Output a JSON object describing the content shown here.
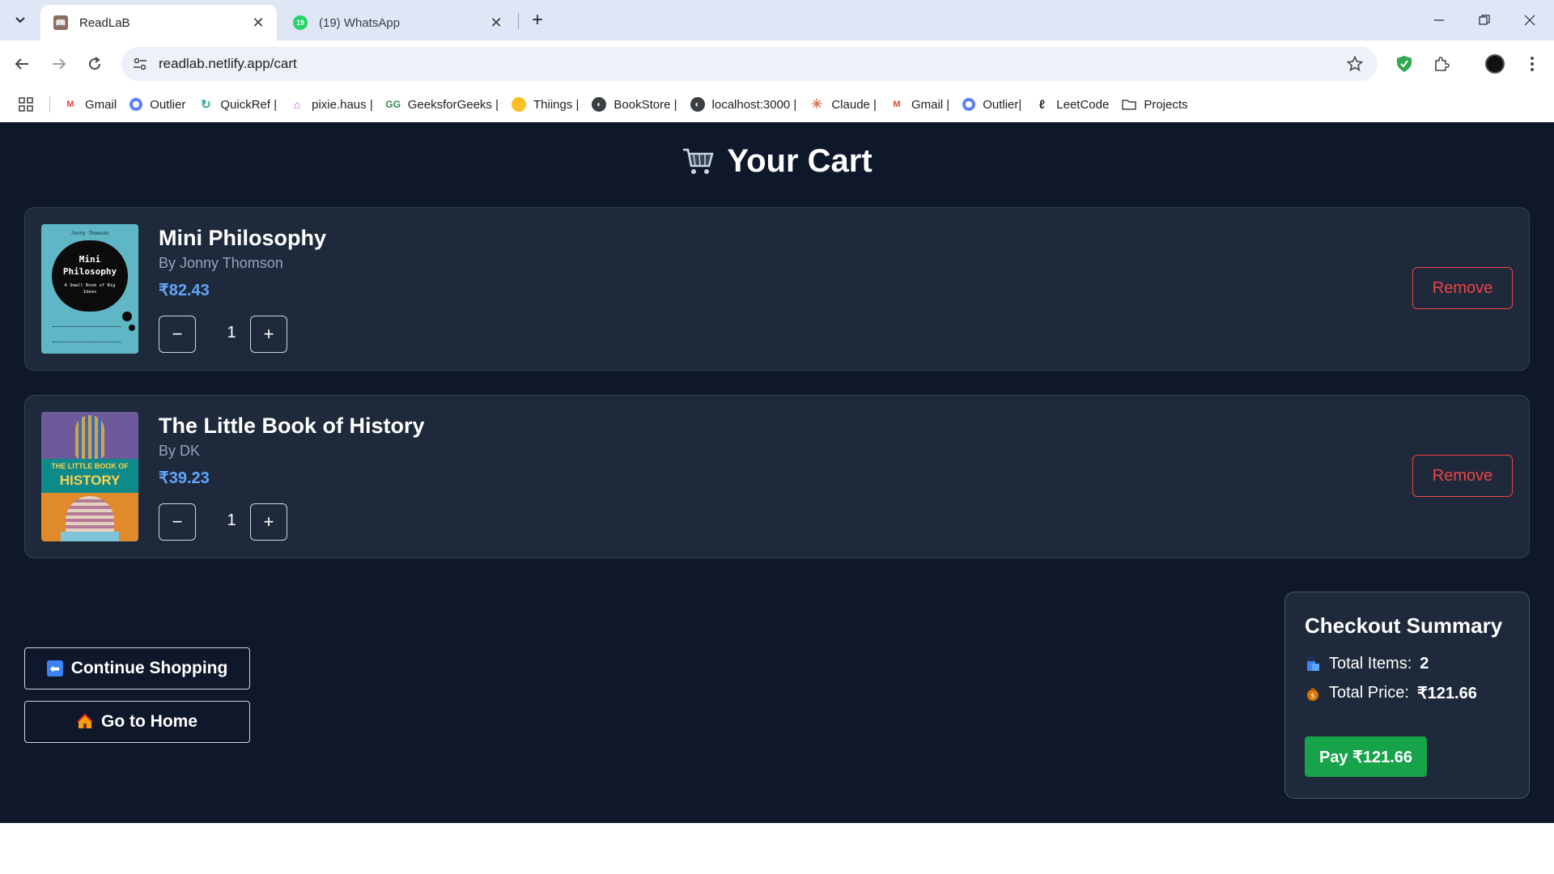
{
  "browser": {
    "tabs": [
      {
        "title": "ReadLaB",
        "active": true
      },
      {
        "title": "(19) WhatsApp",
        "active": false,
        "badge": "19"
      }
    ],
    "url": "readlab.netlify.app/cart",
    "bookmarks": [
      {
        "label": "Gmail",
        "icon": "gmail-icon"
      },
      {
        "label": "Outlier",
        "icon": "outlier-icon"
      },
      {
        "label": "QuickRef |",
        "icon": "quickref-icon"
      },
      {
        "label": "pixie.haus |",
        "icon": "pixie-icon"
      },
      {
        "label": "GeeksforGeeks |",
        "icon": "gfg-icon"
      },
      {
        "label": "Thiings |",
        "icon": "thiings-icon"
      },
      {
        "label": "BookStore |",
        "icon": "globe-icon"
      },
      {
        "label": "localhost:3000 |",
        "icon": "globe-icon"
      },
      {
        "label": "Claude |",
        "icon": "claude-icon"
      },
      {
        "label": "Gmail |",
        "icon": "gmail-icon"
      },
      {
        "label": "Outlier|",
        "icon": "outlier-icon"
      },
      {
        "label": "LeetCode",
        "icon": "leetcode-icon"
      },
      {
        "label": "Projects",
        "icon": "folder-icon"
      }
    ]
  },
  "page": {
    "title": "Your Cart",
    "items": [
      {
        "title": "Mini Philosophy",
        "author": "By Jonny Thomson",
        "price": "₹82.43",
        "quantity": "1",
        "remove_label": "Remove",
        "decrement_label": "−",
        "increment_label": "+",
        "cover": {
          "author": "Jonny Thomson",
          "title": "Mini Philosophy",
          "subtitle": "A Small Book of Big Ideas"
        }
      },
      {
        "title": "The Little Book of History",
        "author": "By DK",
        "price": "₹39.23",
        "quantity": "1",
        "remove_label": "Remove",
        "decrement_label": "−",
        "increment_label": "+",
        "cover": {
          "line1": "THE LITTLE BOOK OF",
          "line2": "HISTORY"
        }
      }
    ],
    "continue_label": "Continue Shopping",
    "home_label": "Go to Home",
    "summary": {
      "title": "Checkout Summary",
      "items_label": "Total Items:",
      "items_value": "2",
      "price_label": "Total Price:",
      "price_value": "₹121.66",
      "pay_label": "Pay ₹121.66"
    }
  },
  "colors": {
    "page_bg": "#0f172a",
    "card_bg": "#1e293b",
    "price": "#60a5fa",
    "remove": "#ef4444",
    "pay": "#16a34a"
  }
}
